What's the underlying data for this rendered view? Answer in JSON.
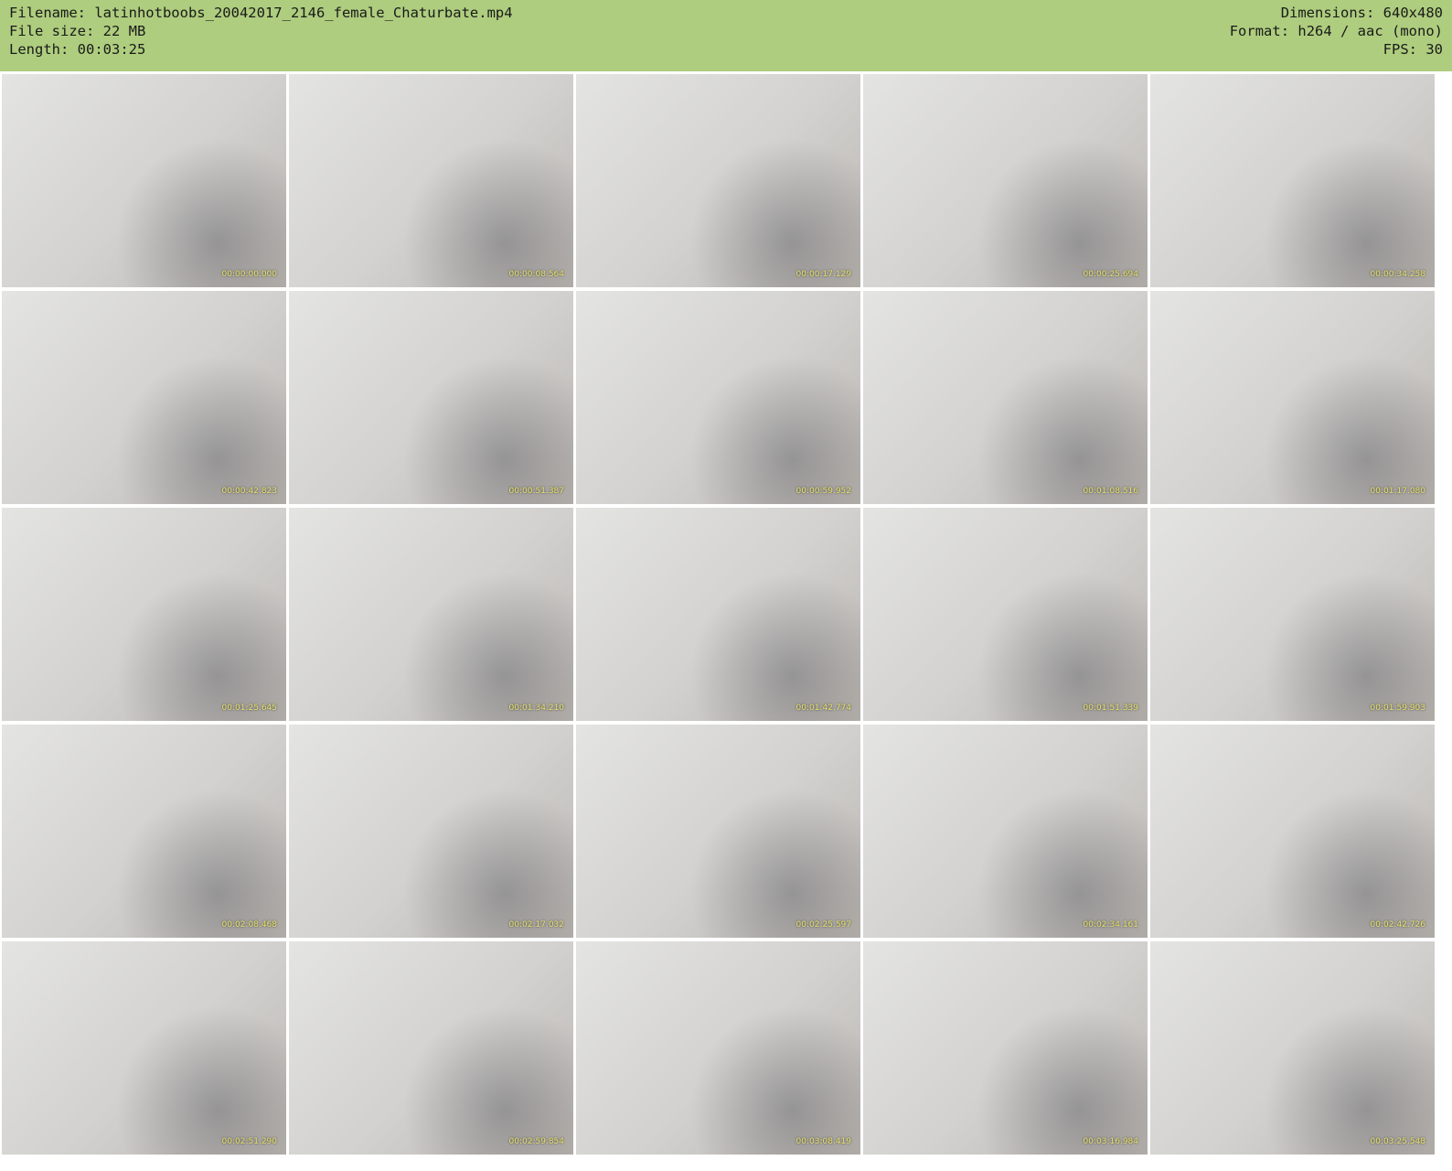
{
  "header": {
    "left": [
      "Filename: latinhotboobs_20042017_2146_female_Chaturbate.mp4",
      "File size: 22 MB",
      "Length: 00:03:25"
    ],
    "right": [
      "Dimensions: 640x480",
      "Format: h264 / aac (mono)",
      "FPS: 30"
    ]
  },
  "frames": [
    "00:00:00.000",
    "00:00:08.564",
    "00:00:17.129",
    "00:00:25.694",
    "00:00:34.258",
    "00:00:42.823",
    "00:00:51.387",
    "00:00:59.952",
    "00:01:08.516",
    "00:01:17.080",
    "00:01:25.645",
    "00:01:34.210",
    "00:01:42.774",
    "00:01:51.339",
    "00:01:59.903",
    "00:02:08.468",
    "00:02:17.032",
    "00:02:25.597",
    "00:02:34.161",
    "00:02:42.726",
    "00:02:51.290",
    "00:02:59.854",
    "00:03:08.419",
    "00:03:16.984",
    "00:03:25.548"
  ]
}
